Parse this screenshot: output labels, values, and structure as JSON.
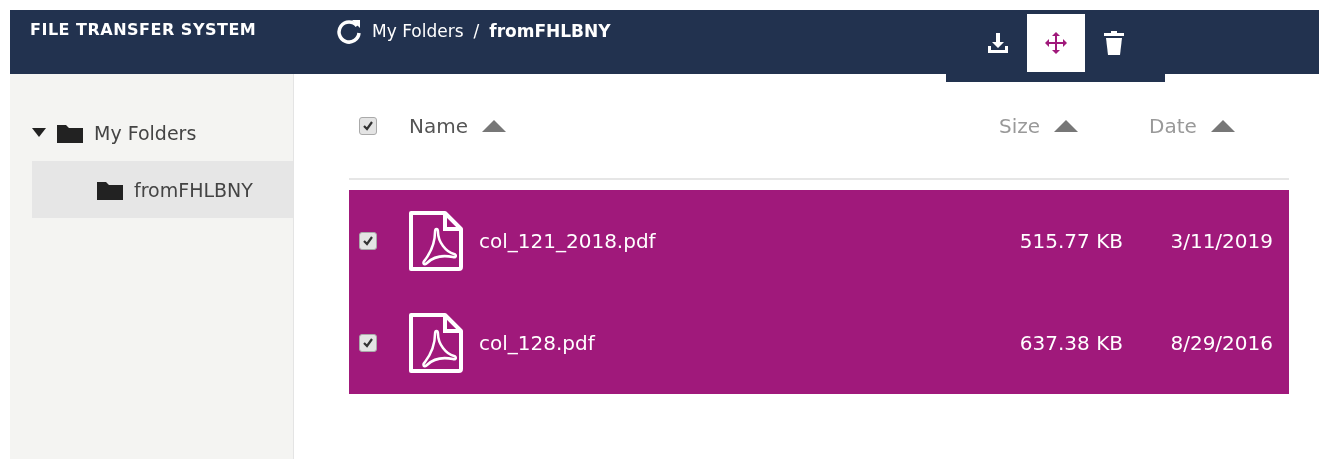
{
  "header": {
    "title": "FILE TRANSFER SYSTEM",
    "breadcrumb": [
      {
        "label": "My Folders",
        "current": false
      },
      {
        "label": "/",
        "current": false
      },
      {
        "label": "fromFHLBNY",
        "current": true
      }
    ],
    "actions": [
      {
        "kind": "download",
        "selected": false
      },
      {
        "kind": "move",
        "selected": true
      },
      {
        "kind": "delete",
        "selected": false
      }
    ]
  },
  "sidebar": {
    "tree": [
      {
        "label": "My Folders",
        "expanded": true,
        "selected": false,
        "children": [
          {
            "label": "fromFHLBNY",
            "selected": true
          }
        ]
      }
    ]
  },
  "table": {
    "select_all": {
      "checked": true
    },
    "columns": [
      {
        "label": "Name",
        "ascending": true
      },
      {
        "label": "Size",
        "ascending": true
      },
      {
        "label": "Date",
        "ascending": true
      }
    ],
    "rows": [
      {
        "name": "col_121_2018.pdf",
        "size": "515.77 KB",
        "date": "3/11/2019",
        "selected": true,
        "checked": true
      },
      {
        "name": "col_128.pdf",
        "size": "637.38 KB",
        "date": "8/29/2016",
        "selected": true,
        "checked": true
      }
    ]
  }
}
